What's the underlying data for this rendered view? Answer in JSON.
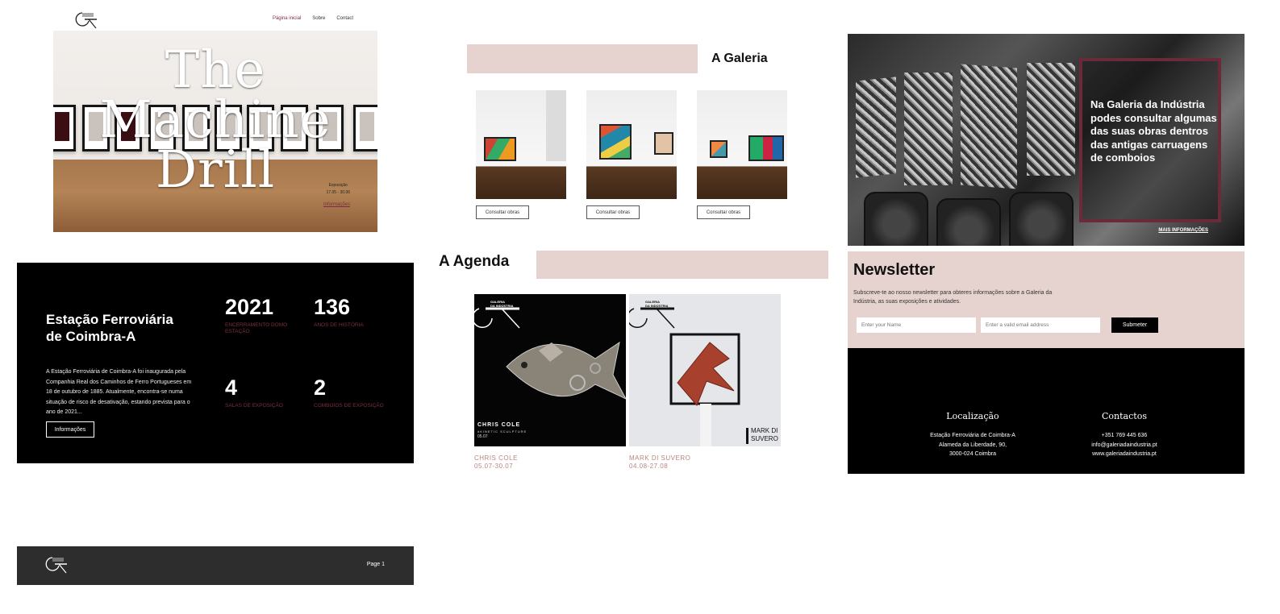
{
  "hero": {
    "nav": [
      "Página inicial",
      "Sobre",
      "Contact"
    ],
    "title_lines": [
      "The",
      "Machine",
      "Drill"
    ],
    "meta_label": "Exposição",
    "meta_dates": "17.05 - 30.06",
    "info_link": "Informações"
  },
  "station": {
    "title": "Estação Ferroviária de Coimbra-A",
    "description": "A Estação Ferroviária de Coimbra-A foi inaugurada pela Companhia Real dos Caminhos de Ferro Portugueses em 18 de outubro de 1885. Atualmente, encontra-se numa situação de risco de desativação, estando prevista para o ano de 2021...",
    "button": "Informações",
    "stats": [
      {
        "value": "2021",
        "label": "ENCERRAMENTO DOMO ESTAÇÃO"
      },
      {
        "value": "136",
        "label": "ANOS DE HISTÓRIA"
      },
      {
        "value": "4",
        "label": "SALAS DE EXPOSIÇÃO"
      },
      {
        "value": "2",
        "label": "COMBOIOS DE EXPOSIÇÃO"
      }
    ]
  },
  "footer": {
    "page_label": "Page 1"
  },
  "galeria": {
    "title": "A Galeria",
    "cards": [
      {
        "button": "Consultar obras"
      },
      {
        "button": "Consultar obras"
      },
      {
        "button": "Consultar obras"
      }
    ]
  },
  "agenda": {
    "title": "A Agenda",
    "logo_text": [
      "GALERIA",
      "DA INDÚSTRIA"
    ],
    "events": [
      {
        "poster_name": "CHRIS COLE",
        "poster_sub": "#KINETIC SCULPTURE",
        "poster_date": "05.07",
        "caption_name": "CHRIS COLE",
        "caption_dates": "05.07-30.07"
      },
      {
        "poster_name": "MARK DI SUVERO",
        "caption_name": "MARK DI SUVERO",
        "caption_dates": "04.08-27.08"
      }
    ]
  },
  "train": {
    "text": "Na Galeria da Indústria podes consultar algumas das suas obras dentros das antigas carruagens de comboios",
    "link": "MAIS INFORMAÇÕES"
  },
  "newsletter": {
    "title": "Newsletter",
    "text": "Subscreve-te ao nosso newsletter para obteres informações sobre a Galeria da Indústria, as suas exposições e atividades.",
    "name_placeholder": "Enter your Name",
    "email_placeholder": "Enter a valid email address",
    "submit": "Submeter"
  },
  "contacts": {
    "location_title": "Localização",
    "location_lines": [
      "Estação Ferroviária de Coimbra-A",
      "Alameda da Liberdade, 90,",
      "3000-024 Coimbra"
    ],
    "contacts_title": "Contactos",
    "contact_lines": [
      "+351 769 445 636",
      "info@galeriadaindustria.pt",
      "www.galeriadaindustria.pt"
    ]
  },
  "colors": {
    "accent": "#7b2f3e",
    "blush": "#e6d3cf",
    "caption": "#b5877f"
  }
}
